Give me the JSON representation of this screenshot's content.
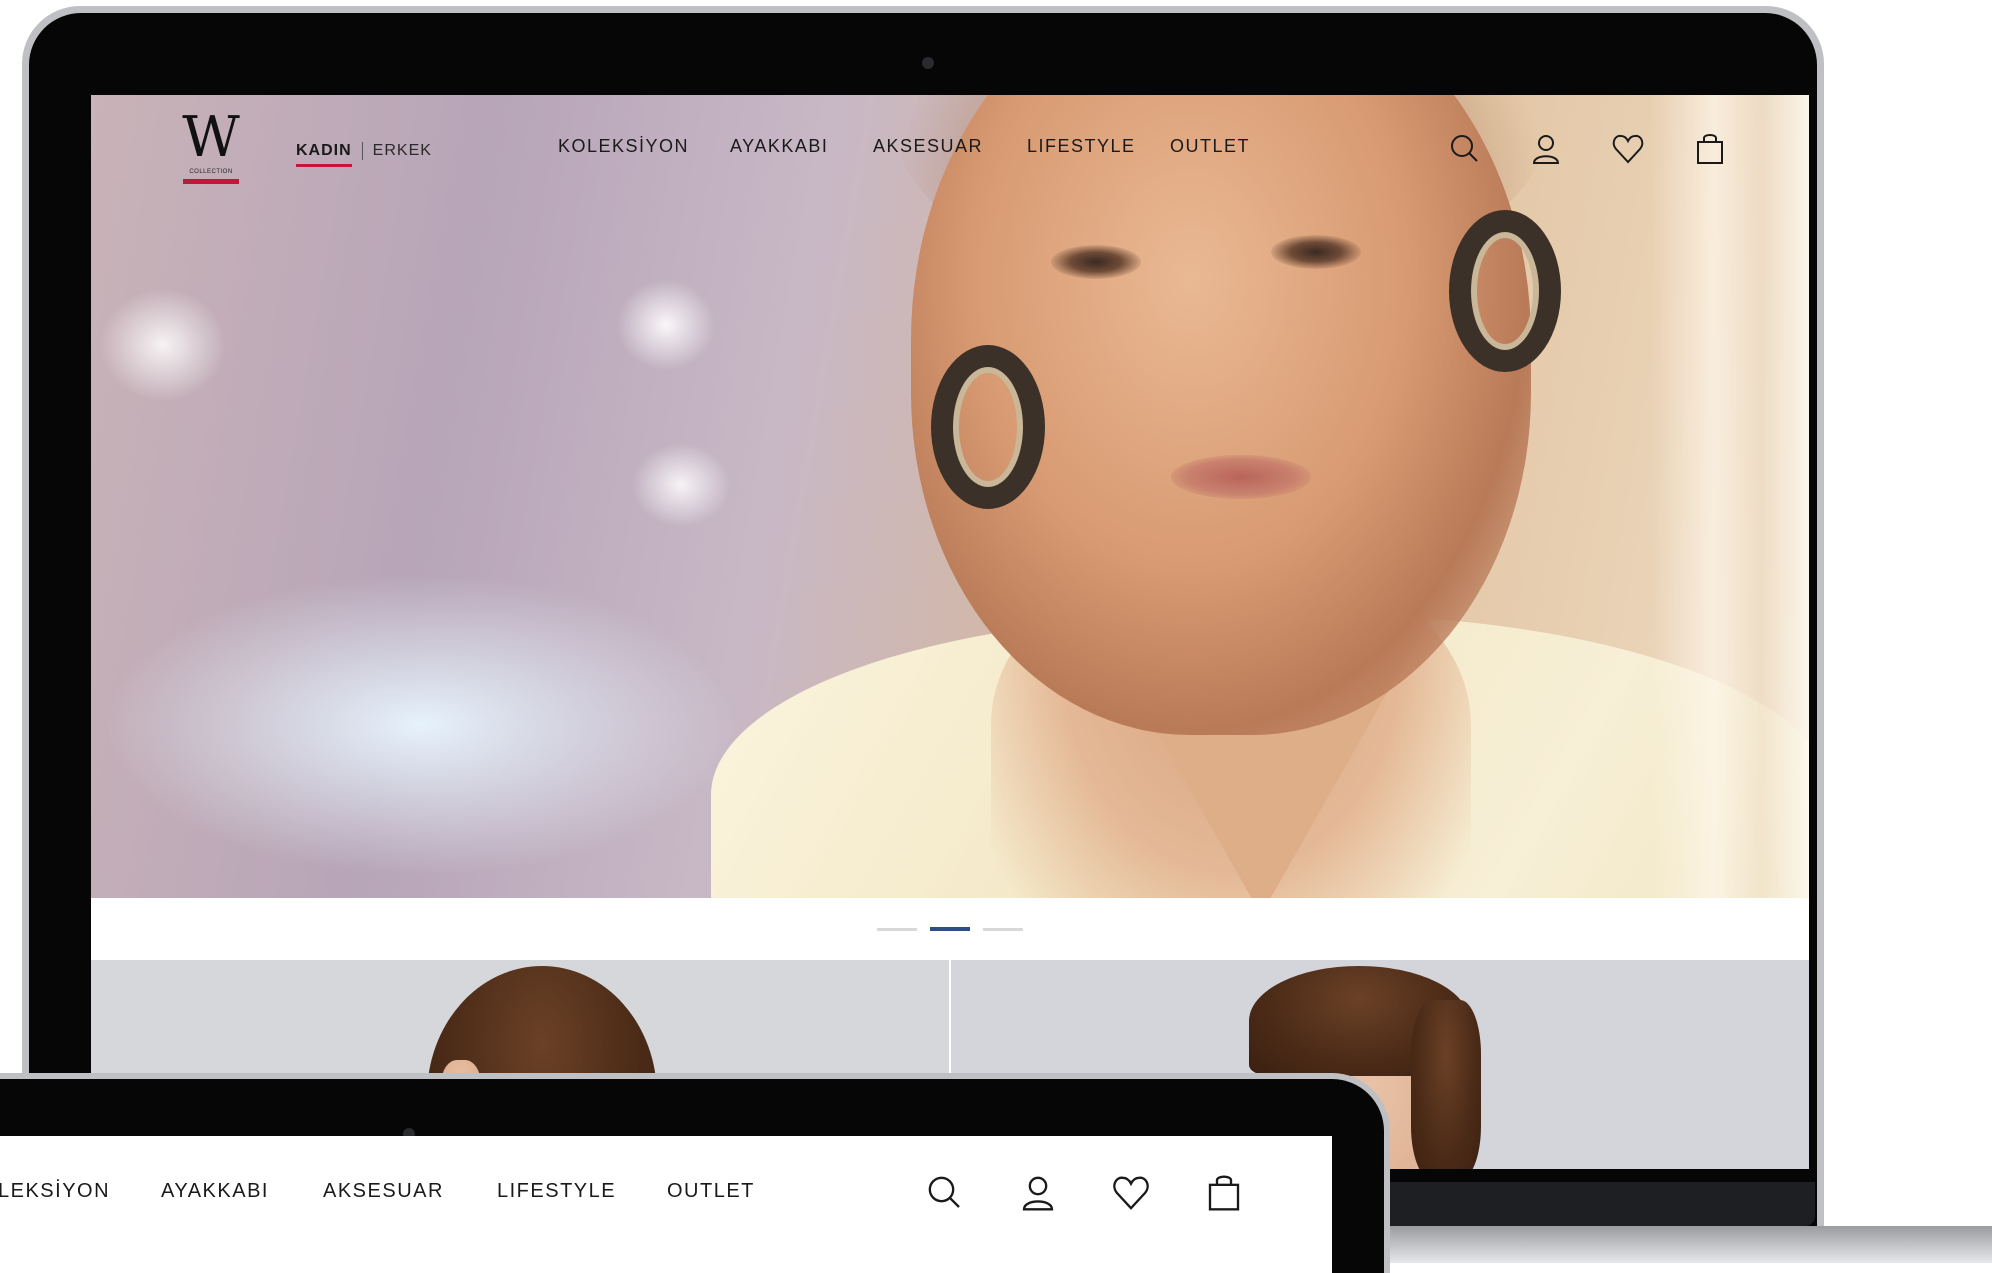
{
  "site": {
    "logo": {
      "mark": "W",
      "subtitle": "COLLECTION",
      "accent_color": "#c4153a"
    },
    "gender_switch": {
      "active": "KADIN",
      "inactive": "ERKEK"
    },
    "menu": [
      "KOLEKSİYON",
      "AYAKKABI",
      "AKSESUAR",
      "LIFESTYLE",
      "OUTLET"
    ],
    "icons": [
      "search-icon",
      "user-icon",
      "heart-icon",
      "bag-icon"
    ],
    "carousel": {
      "slides": 3,
      "active_index": 1,
      "active_color": "#2d4d86"
    }
  },
  "front_device": {
    "menu": [
      "LEKSİYON",
      "AYAKKABI",
      "AKSESUAR",
      "LIFESTYLE",
      "OUTLET"
    ],
    "icons": [
      "search-icon",
      "user-icon",
      "heart-icon",
      "bag-icon"
    ]
  }
}
